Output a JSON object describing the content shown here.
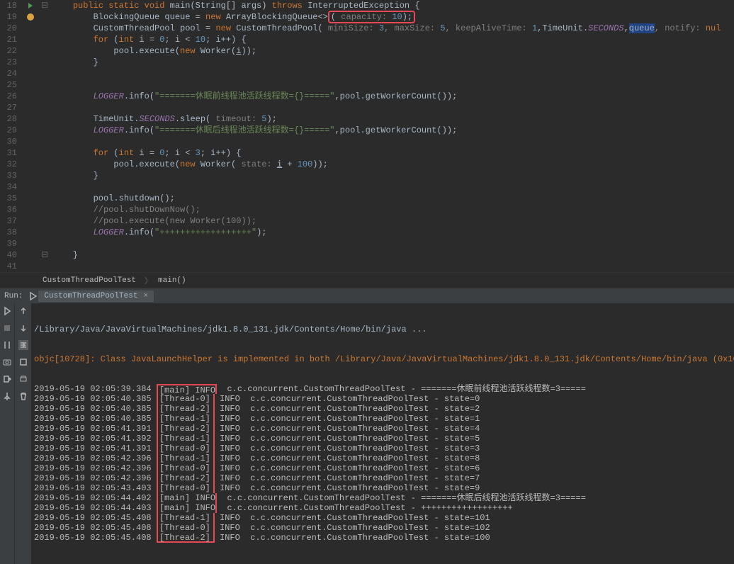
{
  "code": {
    "l18": {
      "n": "18",
      "text": "    public static void main(String[] args) throws InterruptedException {"
    },
    "l19": {
      "n": "19",
      "text": "        BlockingQueue queue = new ArrayBlockingQueue<>",
      "capacity_label": " capacity: ",
      "capacity_val": "10",
      "end": ");"
    },
    "l20": {
      "n": "20",
      "text": "        CustomThreadPool pool = new CustomThreadPool(",
      "p1": " miniSize: ",
      "v1": "3",
      "p2": ", maxSize: ",
      "v2": "5",
      "p3": ", keepAliveTime: ",
      "v3": "1",
      "tu": ",TimeUnit.",
      "sec": "SECONDS",
      "q": ",",
      "q2": "queue",
      "p4": ", notify: ",
      "v4": "nul"
    },
    "l21": {
      "n": "21",
      "text": "        for (int i = 0; i < 10; i++) {"
    },
    "l22": {
      "n": "22",
      "text": "            pool.execute(new Worker(",
      "uvar": "i",
      "end": "));"
    },
    "l23": {
      "n": "23",
      "text": "        }"
    },
    "l24": {
      "n": "24",
      "text": ""
    },
    "l25": {
      "n": "25",
      "text": ""
    },
    "l26": {
      "n": "26",
      "text": "        ",
      "logger": "LOGGER",
      "rest": ".info(",
      "str": "\"=======休眠前线程池活跃线程数={}=====\"",
      "rest2": ",pool.getWorkerCount());"
    },
    "l27": {
      "n": "27",
      "text": ""
    },
    "l28": {
      "n": "28",
      "text": "        TimeUnit.",
      "sec": "SECONDS",
      "rest": ".sleep(",
      "p": " timeout: ",
      "v": "5",
      "end": ");"
    },
    "l29": {
      "n": "29",
      "text": "        ",
      "logger": "LOGGER",
      "rest": ".info(",
      "str": "\"=======休眠后线程池活跃线程数={}=====\"",
      "rest2": ",pool.getWorkerCount());"
    },
    "l30": {
      "n": "30",
      "text": ""
    },
    "l31": {
      "n": "31",
      "text": "        for (int i = 0; i < 3; i++) {"
    },
    "l32": {
      "n": "32",
      "text": "            pool.execute(new Worker(",
      "p": " state: ",
      "uvar": "i",
      "rest": " + ",
      "v": "100",
      "end": "));"
    },
    "l33": {
      "n": "33",
      "text": "        }"
    },
    "l34": {
      "n": "34",
      "text": ""
    },
    "l35": {
      "n": "35",
      "text": "        pool.shutdown();"
    },
    "l36": {
      "n": "36",
      "comment": "        //pool.shutDownNow();"
    },
    "l37": {
      "n": "37",
      "comment": "        //pool.execute(new Worker(100));"
    },
    "l38": {
      "n": "38",
      "text": "        ",
      "logger": "LOGGER",
      "rest": ".info(",
      "str": "\"++++++++++++++++++\"",
      "end": ");"
    },
    "l39": {
      "n": "39",
      "text": ""
    },
    "l40": {
      "n": "40",
      "text": "    }"
    },
    "l41": {
      "n": "41",
      "text": ""
    }
  },
  "breadcrumb": {
    "class": "CustomThreadPoolTest",
    "method": "main()"
  },
  "run": {
    "label": "Run:",
    "tab": "CustomThreadPoolTest"
  },
  "console": {
    "cmd": "/Library/Java/JavaVirtualMachines/jdk1.8.0_131.jdk/Contents/Home/bin/java ...",
    "objc": "objc[10728]: Class JavaLaunchHelper is implemented in both /Library/Java/JavaVirtualMachines/jdk1.8.0_131.jdk/Contents/Home/bin/java (0x10",
    "lines": [
      {
        "ts": "2019-05-19 02:05:39.384",
        "th": "[main] INFO",
        "msg": "  c.c.concurrent.CustomThreadPoolTest - =======休眠前线程池活跃线程数=3====="
      },
      {
        "ts": "2019-05-19 02:05:40.385",
        "th": "[Thread-0]",
        "info": " INFO",
        "msg": "  c.c.concurrent.CustomThreadPoolTest - state=0"
      },
      {
        "ts": "2019-05-19 02:05:40.385",
        "th": "[Thread-2]",
        "info": " INFO",
        "msg": "  c.c.concurrent.CustomThreadPoolTest - state=2"
      },
      {
        "ts": "2019-05-19 02:05:40.385",
        "th": "[Thread-1]",
        "info": " INFO",
        "msg": "  c.c.concurrent.CustomThreadPoolTest - state=1"
      },
      {
        "ts": "2019-05-19 02:05:41.391",
        "th": "[Thread-2]",
        "info": " INFO",
        "msg": "  c.c.concurrent.CustomThreadPoolTest - state=4"
      },
      {
        "ts": "2019-05-19 02:05:41.392",
        "th": "[Thread-1]",
        "info": " INFO",
        "msg": "  c.c.concurrent.CustomThreadPoolTest - state=5"
      },
      {
        "ts": "2019-05-19 02:05:41.391",
        "th": "[Thread-0]",
        "info": " INFO",
        "msg": "  c.c.concurrent.CustomThreadPoolTest - state=3"
      },
      {
        "ts": "2019-05-19 02:05:42.396",
        "th": "[Thread-1]",
        "info": " INFO",
        "msg": "  c.c.concurrent.CustomThreadPoolTest - state=8"
      },
      {
        "ts": "2019-05-19 02:05:42.396",
        "th": "[Thread-0]",
        "info": " INFO",
        "msg": "  c.c.concurrent.CustomThreadPoolTest - state=6"
      },
      {
        "ts": "2019-05-19 02:05:42.396",
        "th": "[Thread-2]",
        "info": " INFO",
        "msg": "  c.c.concurrent.CustomThreadPoolTest - state=7"
      },
      {
        "ts": "2019-05-19 02:05:43.403",
        "th": "[Thread-0]",
        "info": " INFO",
        "msg": "  c.c.concurrent.CustomThreadPoolTest - state=9"
      },
      {
        "ts": "2019-05-19 02:05:44.402",
        "th": "[main] INFO",
        "msg": "  c.c.concurrent.CustomThreadPoolTest - =======休眠后线程池活跃线程数=3====="
      },
      {
        "ts": "2019-05-19 02:05:44.403",
        "th": "[main] INFO",
        "msg": "  c.c.concurrent.CustomThreadPoolTest - ++++++++++++++++++"
      },
      {
        "ts": "2019-05-19 02:05:45.408",
        "th": "[Thread-1]",
        "info": " INFO",
        "msg": "  c.c.concurrent.CustomThreadPoolTest - state=101"
      },
      {
        "ts": "2019-05-19 02:05:45.408",
        "th": "[Thread-0]",
        "info": " INFO",
        "msg": "  c.c.concurrent.CustomThreadPoolTest - state=102"
      },
      {
        "ts": "2019-05-19 02:05:45.408",
        "th": "[Thread-2]",
        "info": " INFO",
        "msg": "  c.c.concurrent.CustomThreadPoolTest - state=100"
      }
    ]
  }
}
